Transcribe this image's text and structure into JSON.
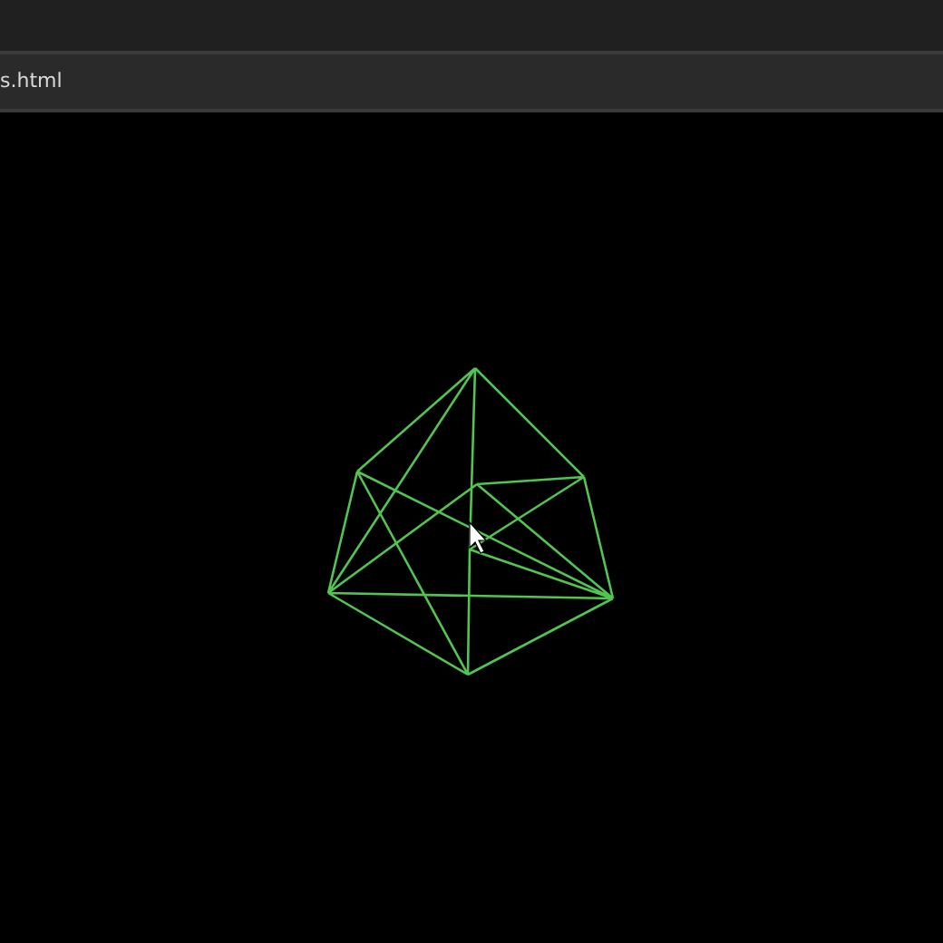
{
  "address_bar": {
    "url": "s.html"
  }
}
